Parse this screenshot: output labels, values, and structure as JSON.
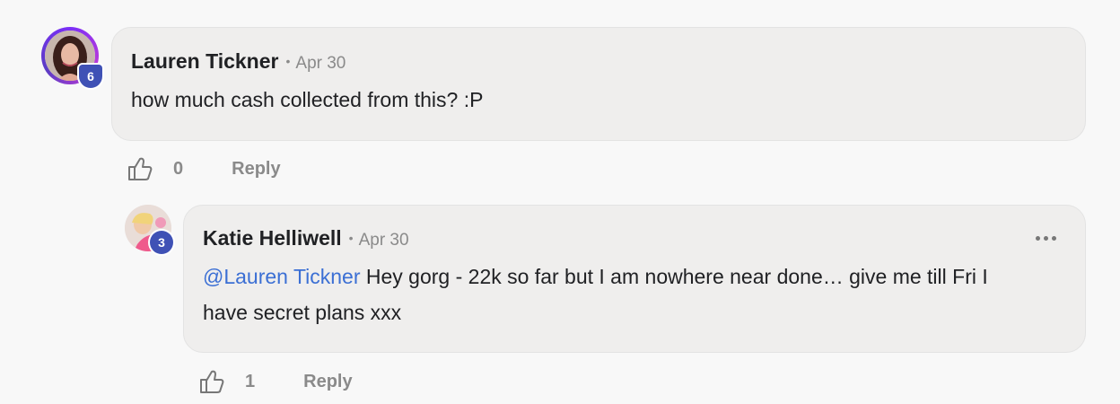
{
  "comments": [
    {
      "author": "Lauren Tickner",
      "separator": "•",
      "date": "Apr 30",
      "text": "how much cash collected from this? :P",
      "level_badge": "6",
      "like_count": "0",
      "reply_label": "Reply",
      "avatar_icon": "user-avatar-photo",
      "like_icon": "thumbs-up-icon"
    },
    {
      "author": "Katie Helliwell",
      "separator": "•",
      "date": "Apr 30",
      "mention": "@Lauren Tickner",
      "text_line1": " Hey gorg - 22k so far but I am nowhere near done… give me till Fri I",
      "text_line2": "have secret plans xxx",
      "level_badge": "3",
      "like_count": "1",
      "reply_label": "Reply",
      "avatar_icon": "user-avatar-photo",
      "like_icon": "thumbs-up-icon",
      "more_icon": "more-horizontal-icon"
    }
  ],
  "colors": {
    "background": "#f8f8f8",
    "bubble": "#efeeed",
    "badge": "#3f51b5",
    "mention": "#3b6fd4",
    "muted": "#8a8a8a"
  }
}
